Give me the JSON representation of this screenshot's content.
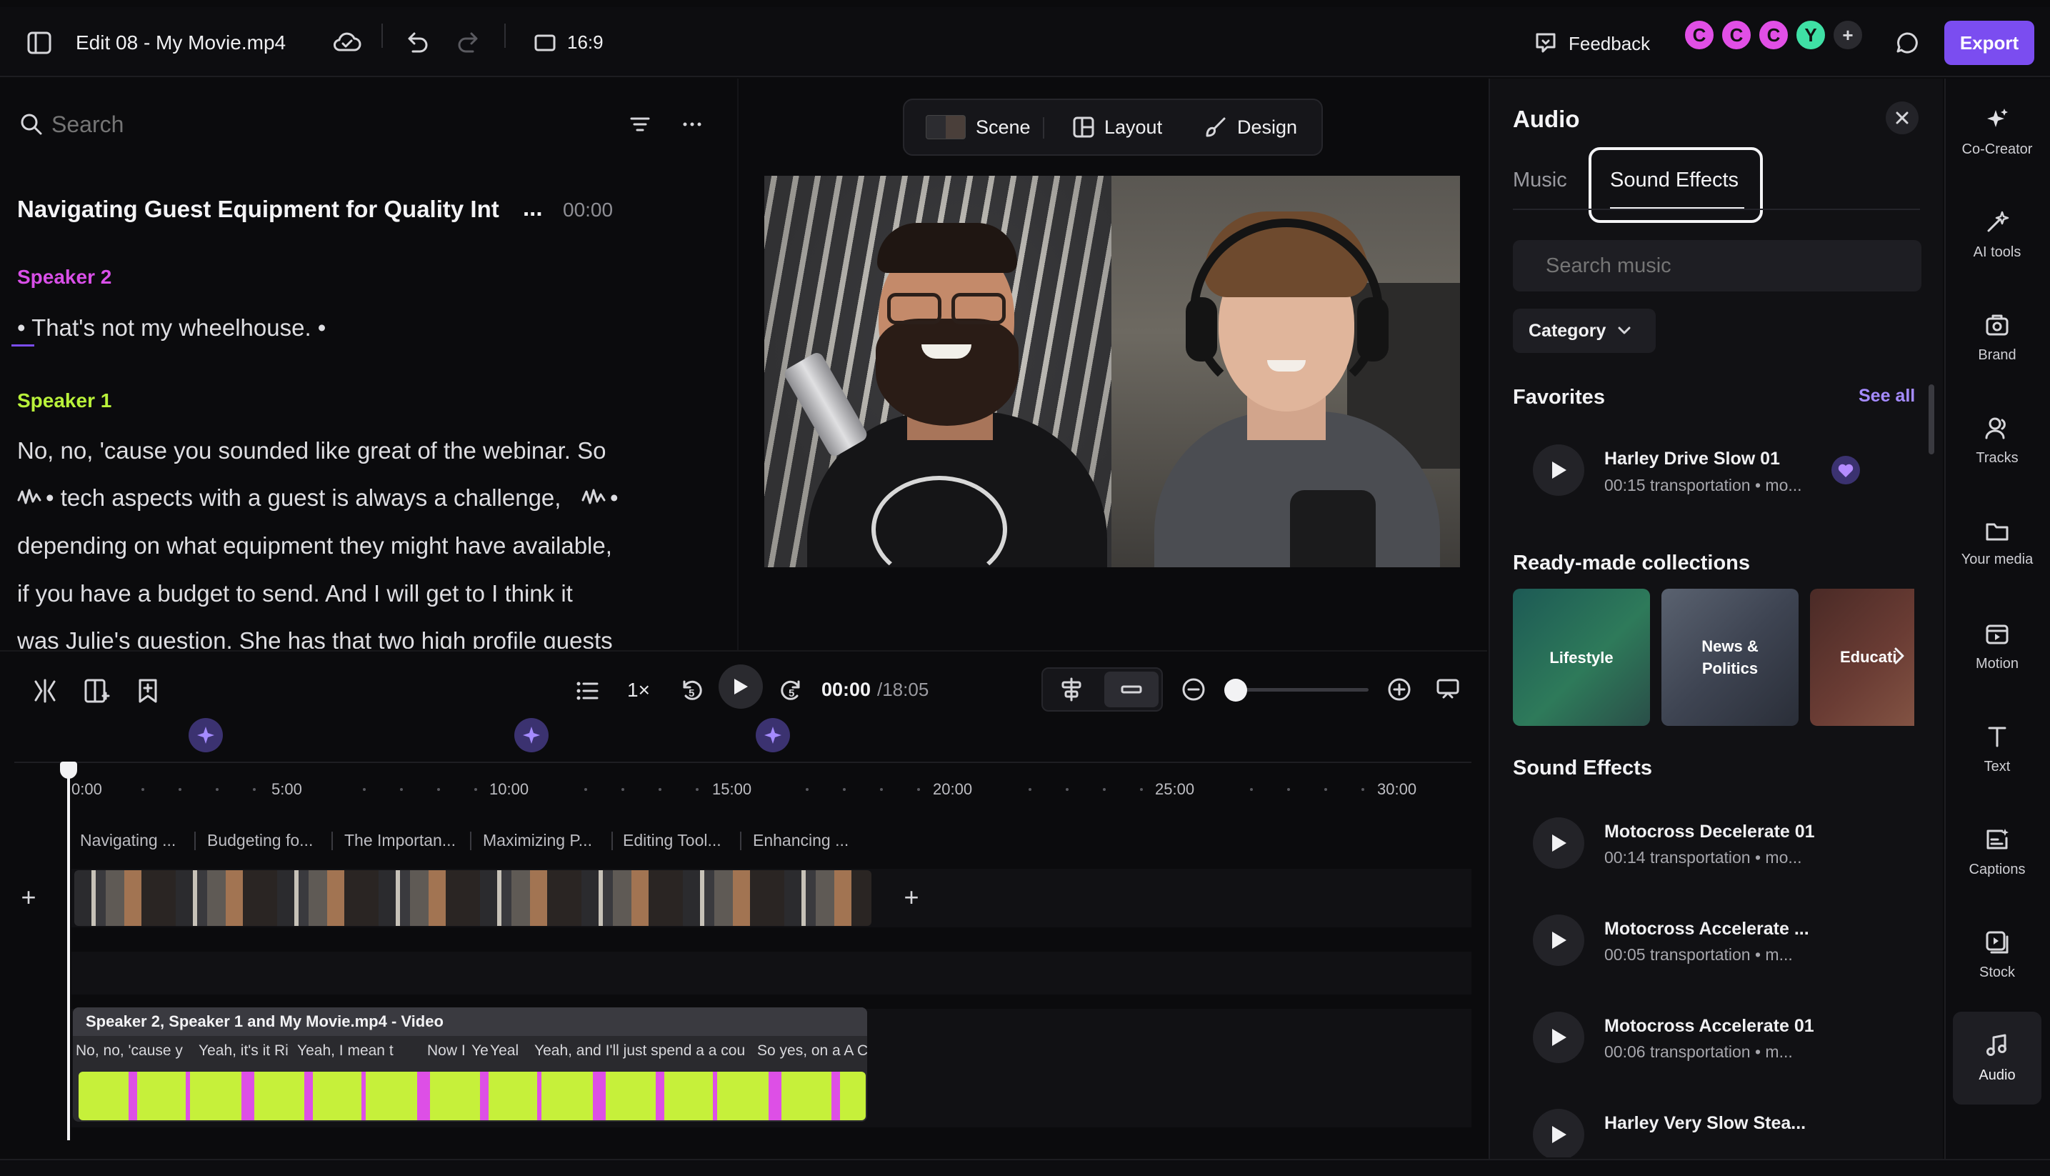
{
  "header": {
    "title": "Edit 08 - My Movie.mp4",
    "aspect": "16:9",
    "feedback": "Feedback",
    "avatars": [
      {
        "letter": "C",
        "color": "#e14fe6"
      },
      {
        "letter": "C",
        "color": "#e14fe6"
      },
      {
        "letter": "C",
        "color": "#e14fe6"
      },
      {
        "letter": "Y",
        "color": "#3fe0a5"
      }
    ],
    "export": "Export"
  },
  "transcript": {
    "search_placeholder": "Search",
    "chapter_title": "Navigating Guest Equipment for Quality Int",
    "chapter_more": "...",
    "chapter_time": "00:00",
    "speaker_a": {
      "name": "Speaker 2",
      "color": "#d94fe8"
    },
    "line_a": "• That's not my wheelhouse. •",
    "speaker_b": {
      "name": "Speaker 1",
      "color": "#b9f23a"
    },
    "lines_b": [
      "No, no, 'cause you sounded like great of the webinar. So",
      "• tech aspects with a guest is always a challenge,",
      "depending on what equipment they might have available,",
      "if you have a budget to send. And I will get to I think it",
      "was Julie's question. She has that two high profile guests"
    ],
    "line_b2_end": "•"
  },
  "preview_toolbar": {
    "scene": "Scene",
    "layout": "Layout",
    "design": "Design"
  },
  "controls": {
    "speed": "1×",
    "current_time": "00:00",
    "total_time": "/18:05",
    "rewind_seconds": "5",
    "forward_seconds": "5",
    "zoom_level": 0.02
  },
  "timeline": {
    "ticks": [
      "0:00",
      "5:00",
      "10:00",
      "15:00",
      "20:00",
      "25:00",
      "30:00"
    ],
    "chapters": [
      "Navigating ...",
      "Budgeting fo...",
      "The Importan...",
      "Maximizing P...",
      "Editing Tool...",
      "Enhancing ..."
    ],
    "audio_clip_title": "Speaker 2, Speaker 1 and My Movie.mp4 - Video",
    "clip_segments": [
      "No, no, 'cause y",
      "Yeah, it's it Ri",
      "Yeah, I mean t",
      "Now I",
      "Ye",
      "Yeal",
      "Yeah, and I'll just spend a a cou",
      "So yes, on a A",
      "C"
    ]
  },
  "audio_panel": {
    "title": "Audio",
    "tabs": [
      "Music",
      "Sound Effects"
    ],
    "active_tab": "Sound Effects",
    "search_placeholder": "Search music",
    "category": "Category",
    "favorites_title": "Favorites",
    "see_all": "See all",
    "favorites": [
      {
        "title": "Harley Drive Slow 01",
        "meta": "00:15 transportation • mo..."
      }
    ],
    "collections_title": "Ready-made collections",
    "collections": [
      "Lifestyle",
      "News & Politics",
      "Educati"
    ],
    "sfx_title": "Sound Effects",
    "sound_effects": [
      {
        "title": "Motocross Decelerate 01",
        "meta": "00:14 transportation • mo..."
      },
      {
        "title": "Motocross Accelerate ...",
        "meta": "00:05 transportation • m..."
      },
      {
        "title": "Motocross Accelerate 01",
        "meta": "00:06 transportation • m..."
      },
      {
        "title": "Harley Very Slow Stea...",
        "meta": ""
      }
    ]
  },
  "rail": {
    "items": [
      {
        "label": "Co-Creator",
        "icon": "sparkle-icon"
      },
      {
        "label": "AI tools",
        "icon": "magic-icon"
      },
      {
        "label": "Brand",
        "icon": "brand-icon"
      },
      {
        "label": "Tracks",
        "icon": "tracks-icon"
      },
      {
        "label": "Your media",
        "icon": "folder-icon"
      },
      {
        "label": "Motion",
        "icon": "motion-icon"
      },
      {
        "label": "Text",
        "icon": "text-icon"
      },
      {
        "label": "Captions",
        "icon": "captions-icon"
      },
      {
        "label": "Stock",
        "icon": "stock-icon"
      },
      {
        "label": "Audio",
        "icon": "audio-icon"
      }
    ],
    "active": "Audio"
  },
  "colors": {
    "accent": "#7b4df0",
    "speaker2": "#d94fe8",
    "speaker1": "#b9f23a"
  }
}
